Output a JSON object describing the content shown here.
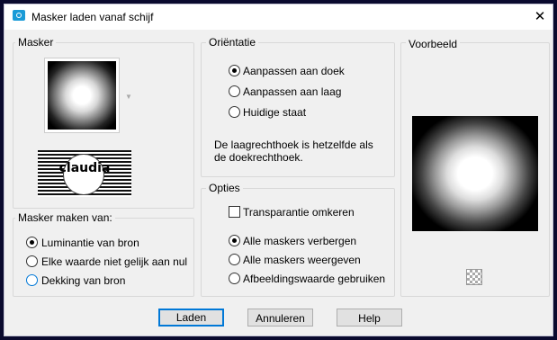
{
  "window": {
    "title": "Masker laden vanaf schijf",
    "close_glyph": "✕"
  },
  "mask_group": {
    "label": "Masker"
  },
  "mask_source": {
    "label": "Masker maken van:",
    "options": [
      {
        "label": "Luminantie van bron",
        "checked": true
      },
      {
        "label": "Elke waarde niet gelijk aan nul",
        "checked": false
      },
      {
        "label": "Dekking van bron",
        "checked": false
      }
    ]
  },
  "logo": {
    "text": "claudia"
  },
  "orientation": {
    "label": "Oriëntatie",
    "options": [
      {
        "label": "Aanpassen aan doek",
        "checked": true
      },
      {
        "label": "Aanpassen aan laag",
        "checked": false
      },
      {
        "label": "Huidige staat",
        "checked": false
      }
    ],
    "note_line1": "De laagrechthoek is hetzelfde als",
    "note_line2": "de doekrechthoek."
  },
  "options": {
    "label": "Opties",
    "invert_label": "Transparantie omkeren",
    "invert_checked": false,
    "radios": [
      {
        "label": "Alle maskers verbergen",
        "checked": true
      },
      {
        "label": "Alle maskers weergeven",
        "checked": false
      },
      {
        "label": "Afbeeldingswaarde gebruiken",
        "checked": false
      }
    ]
  },
  "preview": {
    "label": "Voorbeeld",
    "icon": "checker-icon"
  },
  "buttons": {
    "load": "Laden",
    "cancel": "Annuleren",
    "help": "Help"
  }
}
